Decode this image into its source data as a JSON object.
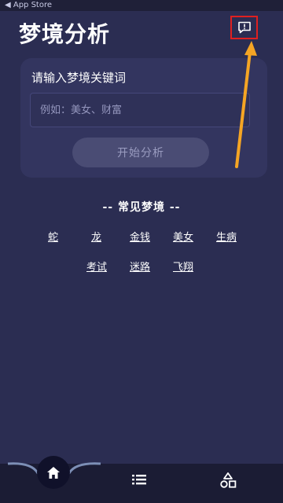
{
  "status_bar": {
    "back_label": "◀ App Store"
  },
  "header": {
    "title": "梦境分析",
    "feedback_icon": "feedback-icon"
  },
  "search_card": {
    "label": "请输入梦境关键词",
    "input_value": "",
    "input_placeholder": "例如：美女、财富",
    "button_label": "开始分析"
  },
  "common_dreams": {
    "title": "-- 常见梦境 --",
    "items": [
      "蛇",
      "龙",
      "金钱",
      "美女",
      "生病",
      "考试",
      "迷路",
      "飞翔"
    ]
  },
  "tab_bar": {
    "tabs": [
      {
        "icon": "home-icon",
        "active": true
      },
      {
        "icon": "list-icon",
        "active": false
      },
      {
        "icon": "shapes-icon",
        "active": false
      }
    ]
  },
  "colors": {
    "background": "#2b2d52",
    "card": "#33355f",
    "button_disabled": "#4a4c74",
    "tab_bar": "#1b1c34",
    "highlight_box": "#e02020",
    "arrow": "#f5a524"
  }
}
